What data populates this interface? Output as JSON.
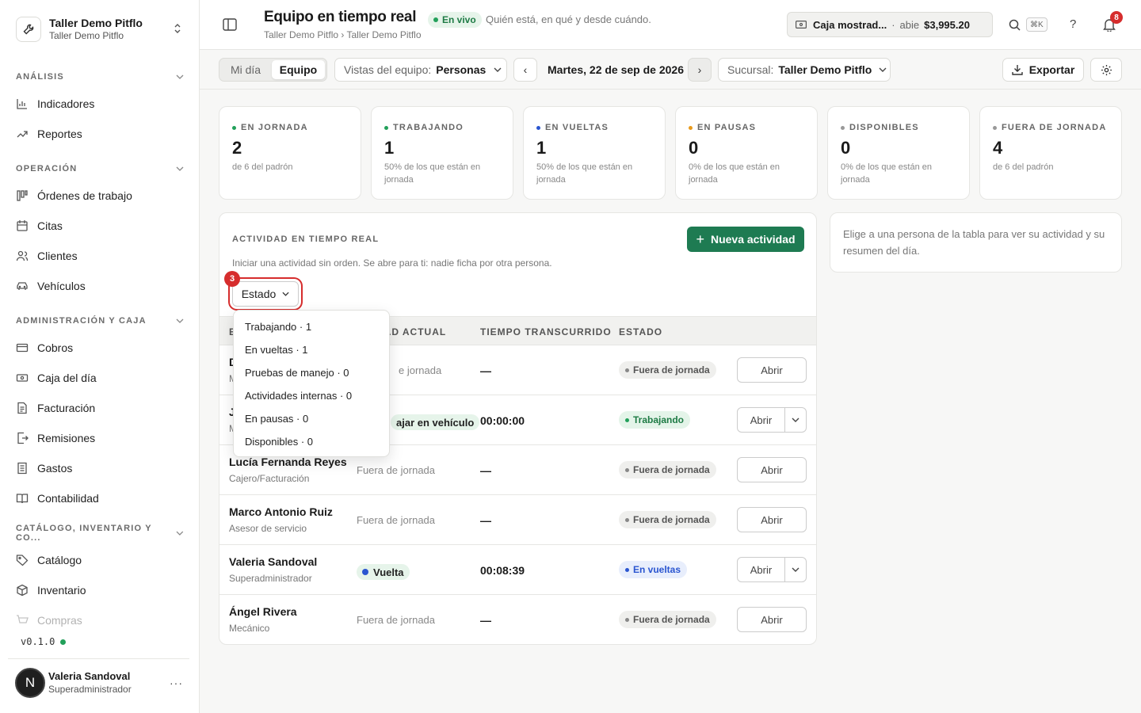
{
  "sidebar": {
    "org_name": "Taller Demo Pitflo",
    "org_sub": "Taller Demo Pitflo",
    "sections": [
      {
        "label": "ANÁLISIS",
        "items": [
          "Indicadores",
          "Reportes"
        ]
      },
      {
        "label": "OPERACIÓN",
        "items": [
          "Órdenes de trabajo",
          "Citas",
          "Clientes",
          "Vehículos"
        ]
      },
      {
        "label": "ADMINISTRACIÓN Y CAJA",
        "items": [
          "Cobros",
          "Caja del día",
          "Facturación",
          "Remisiones",
          "Gastos",
          "Contabilidad"
        ]
      },
      {
        "label": "CATÁLOGO, INVENTARIO Y CO...",
        "items": [
          "Catálogo",
          "Inventario",
          "Compras"
        ]
      }
    ],
    "version": "v0.1.0",
    "user": {
      "initial": "N",
      "name": "Valeria Sandoval",
      "role": "Superadministrador",
      "more": "···"
    }
  },
  "header": {
    "title": "Equipo en tiempo real",
    "live_label": "En vivo",
    "subtitle": "Quién está, en qué y desde cuándo.",
    "breadcrumb": "Taller Demo Pitflo › Taller Demo Pitflo",
    "cashbox": {
      "name": "Caja mostrad...",
      "sep": "·",
      "status": "abie",
      "amount": "$3,995.20"
    },
    "shortcut": "⌘K",
    "help": "?",
    "notifications": "8"
  },
  "toolbar": {
    "tabs": [
      "Mi día",
      "Equipo"
    ],
    "views_label": "Vistas del equipo:",
    "views_value": "Personas",
    "prev": "‹",
    "next": "›",
    "date": "Martes, 22 de sep de 2026",
    "branch_label": "Sucursal:",
    "branch_value": "Taller Demo Pitflo",
    "export": "Exportar"
  },
  "summary": [
    {
      "label": "EN JORNADA",
      "value": "2",
      "sub": "de 6 del padrón",
      "color": "#22a05a"
    },
    {
      "label": "TRABAJANDO",
      "value": "1",
      "sub": "50% de los que están en jornada",
      "color": "#22a05a"
    },
    {
      "label": "EN VUELTAS",
      "value": "1",
      "sub": "50% de los que están en jornada",
      "color": "#2a55d0"
    },
    {
      "label": "EN PAUSAS",
      "value": "0",
      "sub": "0% de los que están en jornada",
      "color": "#e89a1c"
    },
    {
      "label": "DISPONIBLES",
      "value": "0",
      "sub": "0% de los que están en jornada",
      "color": "#999999"
    },
    {
      "label": "FUERA DE JORNADA",
      "value": "4",
      "sub": "de 6 del padrón",
      "color": "#999999"
    }
  ],
  "activity": {
    "title": "ACTIVIDAD EN TIEMPO REAL",
    "new_button": "Nueva actividad",
    "description": "Iniciar una actividad sin orden. Se abre para ti: nadie ficha por otra persona.",
    "filter_label": "Estado",
    "step_badge": "3",
    "columns": [
      "E",
      "DAD ACTUAL",
      "TIEMPO TRANSCURRIDO",
      "ESTADO"
    ],
    "rows": [
      {
        "name": "D",
        "role": "M",
        "activity": "e jornada",
        "time": "—",
        "status": "Fuera de jornada",
        "open": "Abrir"
      },
      {
        "name": "J",
        "role": "M",
        "activity": "ajar en vehículo",
        "time": "00:00:00",
        "status": "Trabajando",
        "open": "Abrir"
      },
      {
        "name": "Lucía Fernanda Reyes",
        "role": "Cajero/Facturación",
        "activity": "Fuera de jornada",
        "time": "—",
        "status": "Fuera de jornada",
        "open": "Abrir"
      },
      {
        "name": "Marco Antonio Ruiz",
        "role": "Asesor de servicio",
        "activity": "Fuera de jornada",
        "time": "—",
        "status": "Fuera de jornada",
        "open": "Abrir"
      },
      {
        "name": "Valeria Sandoval",
        "role": "Superadministrador",
        "activity": "Vuelta",
        "time": "00:08:39",
        "status": "En vueltas",
        "open": "Abrir"
      },
      {
        "name": "Ángel Rivera",
        "role": "Mecánico",
        "activity": "Fuera de jornada",
        "time": "—",
        "status": "Fuera de jornada",
        "open": "Abrir"
      }
    ],
    "menu": [
      "Trabajando · 1",
      "En vueltas · 1",
      "Pruebas de manejo · 0",
      "Actividades internas · 0",
      "En pausas · 0",
      "Disponibles · 0"
    ]
  },
  "detail": {
    "hint": "Elige a una persona de la tabla para ver su actividad y su resumen del día."
  }
}
